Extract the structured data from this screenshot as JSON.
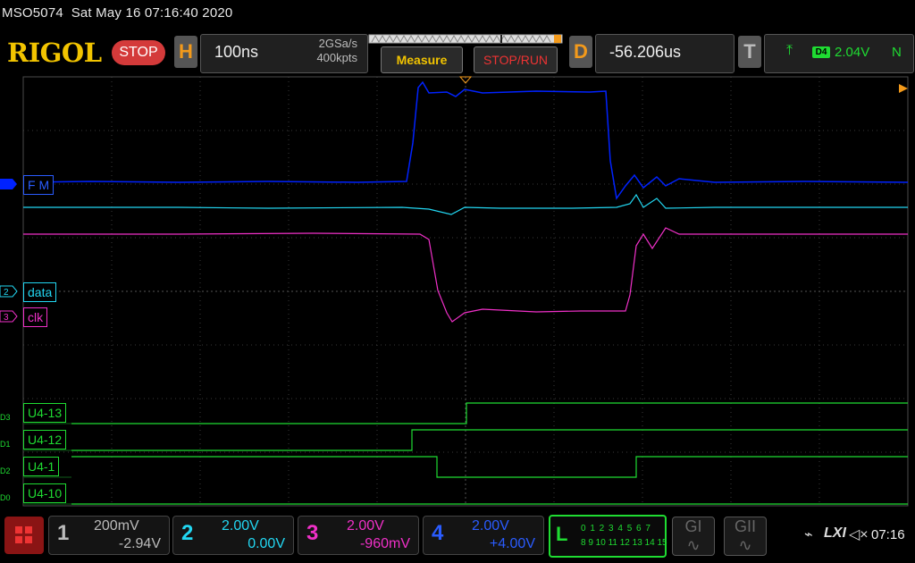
{
  "status": {
    "model": "MSO5074",
    "datetime": "Sat May 16 07:16:40 2020"
  },
  "brand": "RIGOL",
  "run_state": "STOP",
  "horizontal": {
    "key": "H",
    "timebase": "100ns",
    "sample_rate": "2GSa/s",
    "memory_depth": "400kpts"
  },
  "measure_label": "Measure",
  "stoprun_label": "STOP/RUN",
  "delay": {
    "key": "D",
    "value": "-56.206us"
  },
  "trigger": {
    "key": "T",
    "source": "D4",
    "level": "2.04V",
    "mode": "N"
  },
  "traces": {
    "ch1_label": "F M",
    "ch2_label": "data",
    "ch3_label": "clk",
    "ch2_num": "2",
    "ch3_num": "3"
  },
  "digital": [
    {
      "ch": "D3",
      "label": "U4-13"
    },
    {
      "ch": "D1",
      "label": "U4-12"
    },
    {
      "ch": "D2",
      "label": "U4-1"
    },
    {
      "ch": "D0",
      "label": "U4-10"
    }
  ],
  "channels": [
    {
      "num": "1",
      "scale": "200mV",
      "offset": "-2.94V",
      "color": "#bbbbbb"
    },
    {
      "num": "2",
      "scale": "2.00V",
      "offset": "0.00V",
      "color": "#22d7f2"
    },
    {
      "num": "3",
      "scale": "2.00V",
      "offset": "-960mV",
      "color": "#f030c8"
    },
    {
      "num": "4",
      "scale": "2.00V",
      "offset": "+4.00V",
      "color": "#2a5cff"
    }
  ],
  "logic": {
    "key": "L",
    "row1": "0 1 2 3  4 5 6 7",
    "row2": "8 9 10 11 12 13 14 15"
  },
  "gen1": "GI",
  "gen2": "GII",
  "clock": "07:16",
  "colors": {
    "ch1": "#0022ff",
    "ch2": "#22d7f2",
    "ch3": "#f030c8",
    "digital": "#1fdc32",
    "accent": "#f39a1b"
  }
}
